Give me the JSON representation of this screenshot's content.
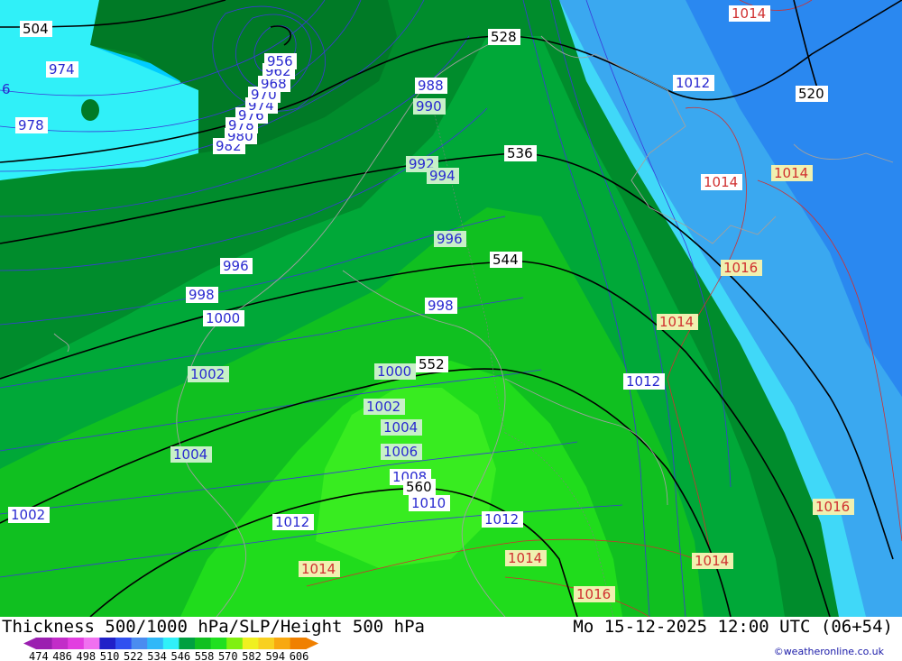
{
  "map": {
    "slp_labels_blue": [
      "974",
      "978",
      "982",
      "980",
      "978",
      "976",
      "974",
      "970",
      "968",
      "962",
      "956",
      "988",
      "990",
      "992",
      "994",
      "996",
      "996",
      "998",
      "998",
      "1000",
      "1000",
      "1002",
      "1002",
      "1004",
      "1004",
      "1006",
      "1008",
      "1010",
      "1012",
      "1012",
      "1012",
      "1012",
      "1002"
    ],
    "slp_labels_red": [
      "1014",
      "1014",
      "1014",
      "1014",
      "1014",
      "1014",
      "1014",
      "1016",
      "1016",
      "1016",
      "1016"
    ],
    "height_labels": [
      "504",
      "520",
      "528",
      "536",
      "544",
      "552",
      "560"
    ],
    "edge_label": "6"
  },
  "title": {
    "left": "Thickness 500/1000 hPa/SLP/Height 500 hPa",
    "right": "Mo 15-12-2025 12:00 UTC (06+54)"
  },
  "legend": {
    "ticks": [
      "474",
      "486",
      "498",
      "510",
      "522",
      "534",
      "546",
      "558",
      "570",
      "582",
      "594",
      "606"
    ],
    "colors": [
      "#9b1fb0",
      "#c22cc8",
      "#e23de0",
      "#f070f0",
      "#2020c8",
      "#3050f0",
      "#4a8cf0",
      "#30b8f8",
      "#30f0f8",
      "#00a040",
      "#10c020",
      "#20e020",
      "#80f010",
      "#f0f020",
      "#f8d020",
      "#f8a810",
      "#f08000"
    ]
  },
  "credit": "©weatheronline.co.uk"
}
